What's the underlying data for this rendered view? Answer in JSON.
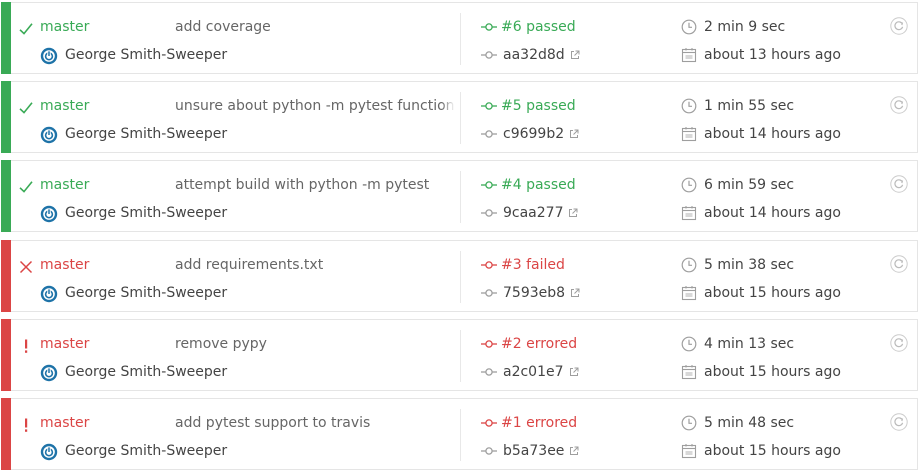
{
  "colors": {
    "passed": "#39aa56",
    "failed": "#db4545",
    "errored": "#db4545",
    "text": "#444444",
    "muted": "#9e9e9e"
  },
  "icons": {
    "status_passed": "check-icon",
    "status_failed": "x-icon",
    "status_errored": "exclamation-icon",
    "avatar": "power-icon",
    "build": "commit-dot-icon",
    "commit": "commit-dot-icon",
    "external": "external-link-icon",
    "duration": "clock-icon",
    "finished": "calendar-icon",
    "restart": "restart-icon"
  },
  "builds": [
    {
      "state": "passed",
      "branch": "master",
      "message": "add coverage",
      "author": "George Smith-Sweeper",
      "build_label": "#6 passed",
      "commit": "aa32d8d",
      "duration": "2 min 9 sec",
      "finished": "about 13 hours ago"
    },
    {
      "state": "passed",
      "branch": "master",
      "message": "unsure about python -m pytest functionality,",
      "author": "George Smith-Sweeper",
      "build_label": "#5 passed",
      "commit": "c9699b2",
      "duration": "1 min 55 sec",
      "finished": "about 14 hours ago"
    },
    {
      "state": "passed",
      "branch": "master",
      "message": "attempt build with python -m pytest",
      "author": "George Smith-Sweeper",
      "build_label": "#4 passed",
      "commit": "9caa277",
      "duration": "6 min 59 sec",
      "finished": "about 14 hours ago"
    },
    {
      "state": "failed",
      "branch": "master",
      "message": "add requirements.txt",
      "author": "George Smith-Sweeper",
      "build_label": "#3 failed",
      "commit": "7593eb8",
      "duration": "5 min 38 sec",
      "finished": "about 15 hours ago"
    },
    {
      "state": "errored",
      "branch": "master",
      "message": "remove pypy",
      "author": "George Smith-Sweeper",
      "build_label": "#2 errored",
      "commit": "a2c01e7",
      "duration": "4 min 13 sec",
      "finished": "about 15 hours ago"
    },
    {
      "state": "errored",
      "branch": "master",
      "message": "add pytest support to travis",
      "author": "George Smith-Sweeper",
      "build_label": "#1 errored",
      "commit": "b5a73ee",
      "duration": "5 min 48 sec",
      "finished": "about 15 hours ago"
    }
  ]
}
